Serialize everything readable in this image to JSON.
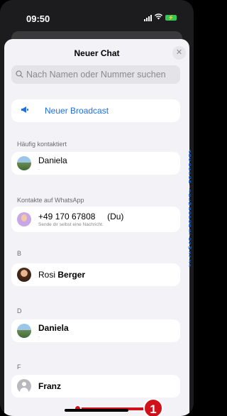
{
  "status_bar": {
    "time": "09:50",
    "wifi_icon": "wifi-icon",
    "battery_icon": "battery-charging-icon",
    "signal_icon": "cellular-signal-icon"
  },
  "sheet": {
    "title": "Neuer Chat",
    "close_glyph": "✕",
    "search_placeholder": "Nach Namen oder Nummer suchen",
    "search_value": ""
  },
  "broadcast": {
    "icon": "megaphone-icon",
    "label": "Neuer Broadcast"
  },
  "sections": [
    {
      "header": "Häufig kontaktiert",
      "contacts": [
        {
          "name": "Daniela",
          "subtitle": ".",
          "avatar": "landscape"
        }
      ]
    },
    {
      "header": "Kontakte auf WhatsApp",
      "contacts": [
        {
          "name": "+49 170 67808     (Du)",
          "subtitle": "Sende dir selbst eine Nachricht.",
          "avatar": "memoji"
        }
      ]
    },
    {
      "header": "B",
      "contacts": [
        {
          "name_first": "Rosi",
          "name_last": "Berger",
          "avatar": "photo"
        }
      ]
    },
    {
      "header": "D",
      "contacts": [
        {
          "name": "Daniela",
          "subtitle": ".",
          "avatar": "landscape"
        }
      ]
    },
    {
      "header": "F",
      "contacts": [
        {
          "name": "Franz",
          "avatar": "grey"
        }
      ]
    }
  ],
  "alphabet_index": [
    "A",
    "B",
    "C",
    "D",
    "E",
    "F",
    "G",
    "H",
    "I",
    "J",
    "K",
    "L",
    "M",
    "N",
    "O",
    "P",
    "Q",
    "R",
    "S",
    "T",
    "U",
    "V",
    "W",
    "X",
    "Y",
    "Z",
    "#"
  ],
  "callout": {
    "number": "1",
    "color": "#d0101a"
  },
  "colors": {
    "accent": "#1e6ee8",
    "sheet_bg": "#f2f2f7",
    "battery": "#34c759"
  }
}
